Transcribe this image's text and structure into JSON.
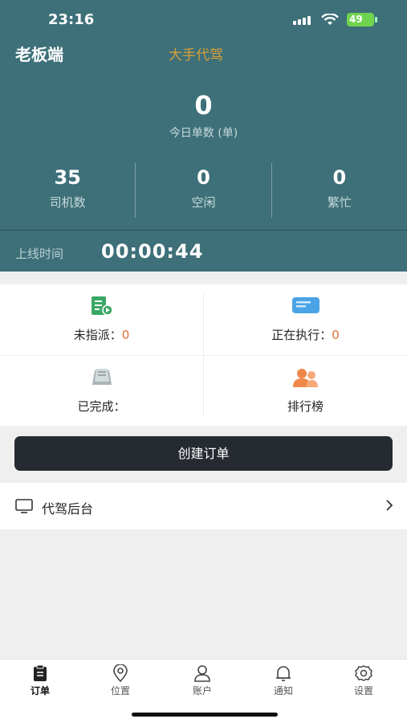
{
  "status_bar": {
    "time": "23:16",
    "battery": "49"
  },
  "header": {
    "role": "老板端",
    "brand": "大手代驾"
  },
  "today": {
    "value": "0",
    "label": "今日单数 (单)"
  },
  "stats": [
    {
      "value": "35",
      "label": "司机数"
    },
    {
      "value": "0",
      "label": "空闲"
    },
    {
      "value": "0",
      "label": "繁忙"
    }
  ],
  "online": {
    "label": "上线时间",
    "time": "00:00:44"
  },
  "grid": {
    "unassigned": {
      "label": "未指派：",
      "value": "0",
      "icon": "unassigned-order-icon"
    },
    "executing": {
      "label": "正在执行：",
      "value": "0",
      "icon": "executing-chat-icon"
    },
    "completed": {
      "label": "已完成：",
      "icon": "completed-stack-icon"
    },
    "ranking": {
      "label": "排行榜",
      "icon": "ranking-users-icon"
    }
  },
  "create_button": "创建订单",
  "backend": {
    "label": "代驾后台",
    "icon": "monitor-icon"
  },
  "tabs": [
    {
      "label": "订单",
      "icon": "clipboard-icon"
    },
    {
      "label": "位置",
      "icon": "location-pin-icon"
    },
    {
      "label": "账户",
      "icon": "user-icon"
    },
    {
      "label": "通知",
      "icon": "bell-icon"
    },
    {
      "label": "设置",
      "icon": "gear-icon"
    }
  ],
  "colors": {
    "header_bg": "#3e7079",
    "brand": "#d8a037",
    "accent_value": "#e0713a",
    "button_dark": "#262a31",
    "battery": "#6fd34f"
  }
}
